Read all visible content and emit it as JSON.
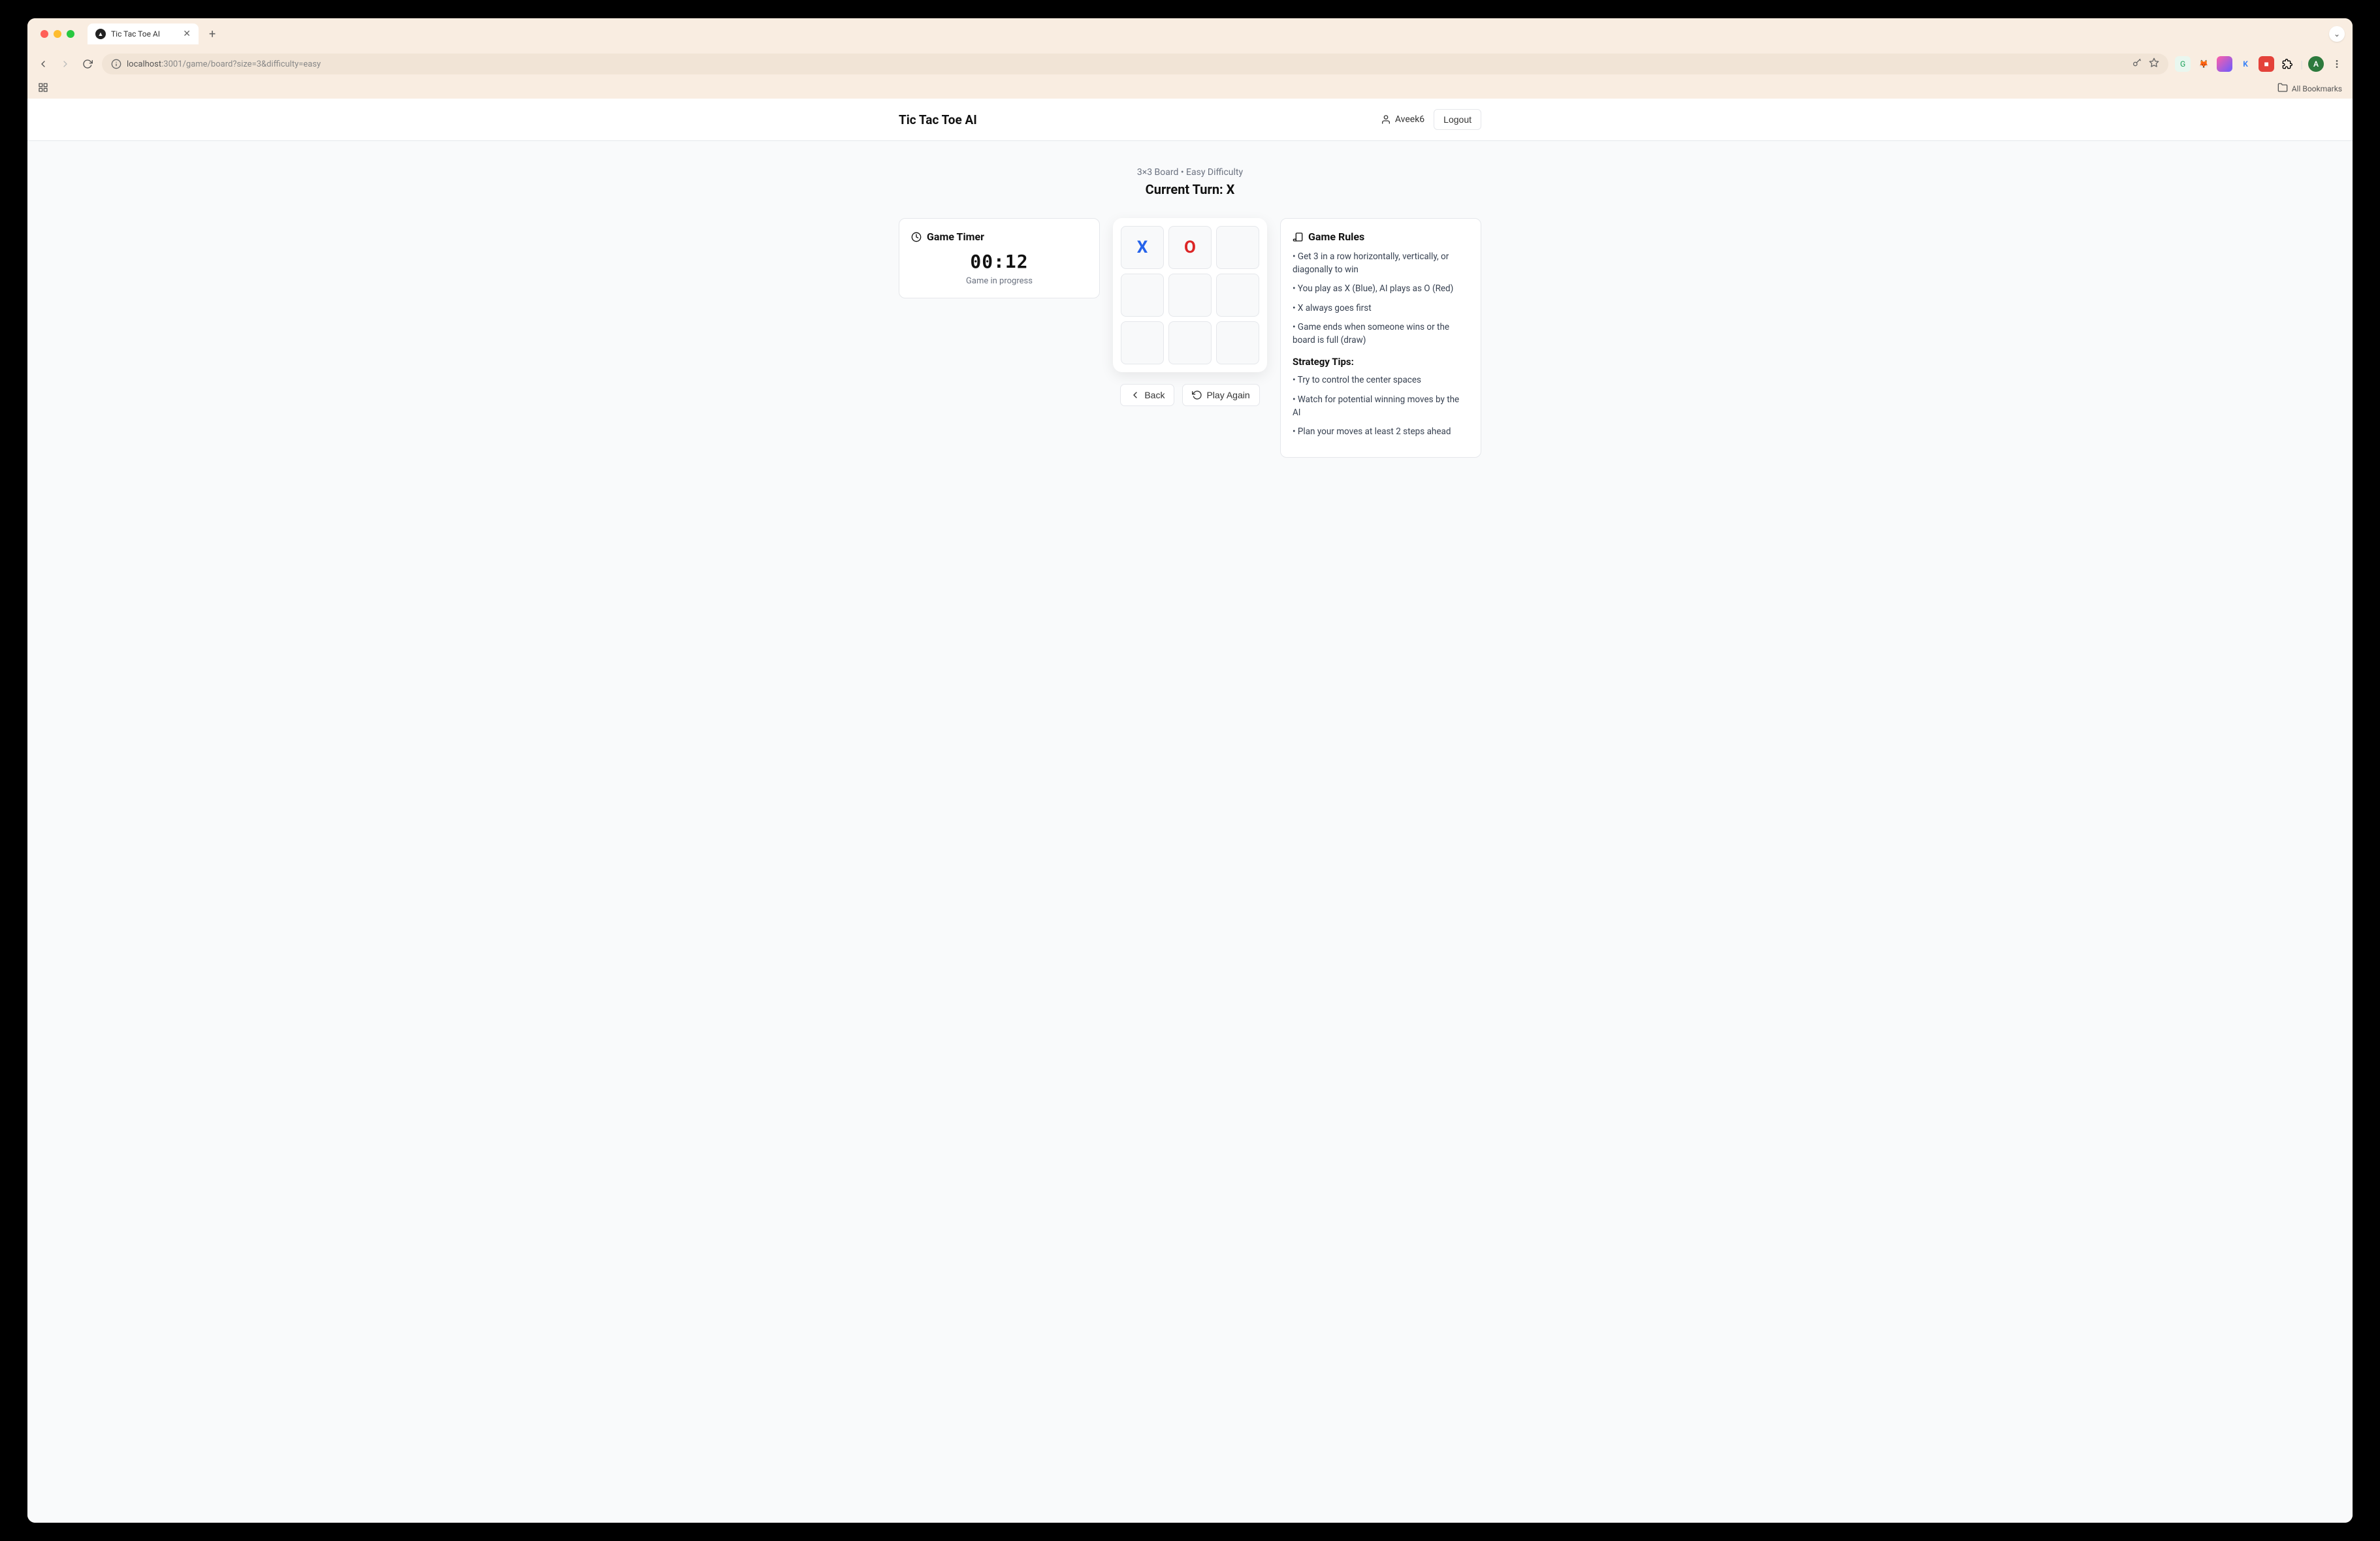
{
  "browser": {
    "tab_title": "Tic Tac Toe AI",
    "url_host": "localhost",
    "url_path": ":3001/game/board?size=3&difficulty=easy",
    "bookmarks_label": "All Bookmarks",
    "profile_initial": "A"
  },
  "header": {
    "app_title": "Tic Tac Toe AI",
    "username": "Aveek6",
    "logout_label": "Logout"
  },
  "game": {
    "meta": "3×3 Board • Easy Difficulty",
    "turn_prefix": "Current Turn: ",
    "turn_player": "X"
  },
  "timer": {
    "title": "Game Timer",
    "value": "00:12",
    "status": "Game in progress"
  },
  "board": {
    "cells": [
      "X",
      "O",
      "",
      "",
      "",
      "",
      "",
      "",
      ""
    ]
  },
  "actions": {
    "back_label": "Back",
    "play_again_label": "Play Again"
  },
  "rules": {
    "title": "Game Rules",
    "items": [
      "• Get 3 in a row horizontally, vertically, or diagonally to win",
      "• You play as X (Blue), AI plays as O (Red)",
      "• X always goes first",
      "• Game ends when someone wins or the board is full (draw)"
    ],
    "tips_title": "Strategy Tips:",
    "tips": [
      "• Try to control the center spaces",
      "• Watch for potential winning moves by the AI",
      "• Plan your moves at least 2 steps ahead"
    ]
  }
}
